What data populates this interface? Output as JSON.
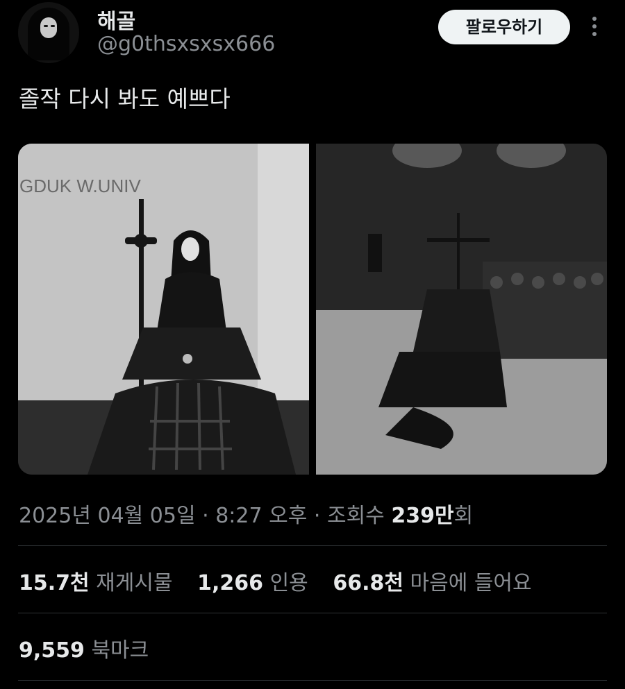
{
  "author": {
    "display_name": "해골",
    "handle": "@g0thsxsxsx666"
  },
  "follow_button_label": "팔로우하기",
  "tweet_text": "졸작 다시 봐도 예쁘다",
  "media": {
    "left_sign_text": "GDUK W.UNIV"
  },
  "timestamp": {
    "date": "2025년 04월 05일",
    "separator": "·",
    "time": "8:27 오후",
    "views_label": "조회수",
    "views_value": "239만",
    "views_suffix": "회"
  },
  "stats": {
    "retweets_value": "15.7천",
    "retweets_label": "재게시물",
    "quotes_value": "1,266",
    "quotes_label": "인용",
    "likes_value": "66.8천",
    "likes_label": "마음에 들어요"
  },
  "bookmarks": {
    "value": "9,559",
    "label": "북마크"
  }
}
